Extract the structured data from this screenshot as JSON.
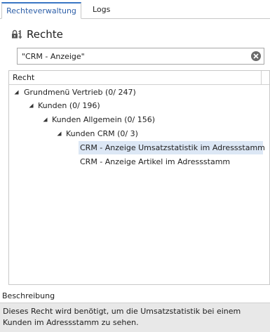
{
  "tabs": [
    {
      "label": "Rechteverwaltung",
      "active": true
    },
    {
      "label": "Logs",
      "active": false
    }
  ],
  "header": {
    "title": "Rechte",
    "icon": "lock-key-icon"
  },
  "search": {
    "value": "\"CRM - Anzeige\"",
    "clear_icon": "clear-icon"
  },
  "tree": {
    "column_header": "Recht",
    "nodes": [
      {
        "label": "Grundmenü Vertrieb (0/ 247)",
        "expanded": true
      },
      {
        "label": "Kunden (0/ 196)",
        "expanded": true
      },
      {
        "label": "Kunden Allgemein (0/ 156)",
        "expanded": true
      },
      {
        "label": "Kunden CRM (0/ 3)",
        "expanded": true
      },
      {
        "label": "CRM - Anzeige Umsatzstatistik im Adressstamm",
        "selected": true
      },
      {
        "label": "CRM - Anzeige Artikel im Adressstamm",
        "selected": false
      }
    ]
  },
  "description": {
    "label": "Beschreibung",
    "text": "Dieses Recht wird benötigt, um die Umsatzstatistik bei einem Kunden im Adressstamm zu sehen."
  },
  "colors": {
    "accent": "#3a76c4",
    "selection": "#dce7f5",
    "description_bg": "#e8e8e8"
  }
}
